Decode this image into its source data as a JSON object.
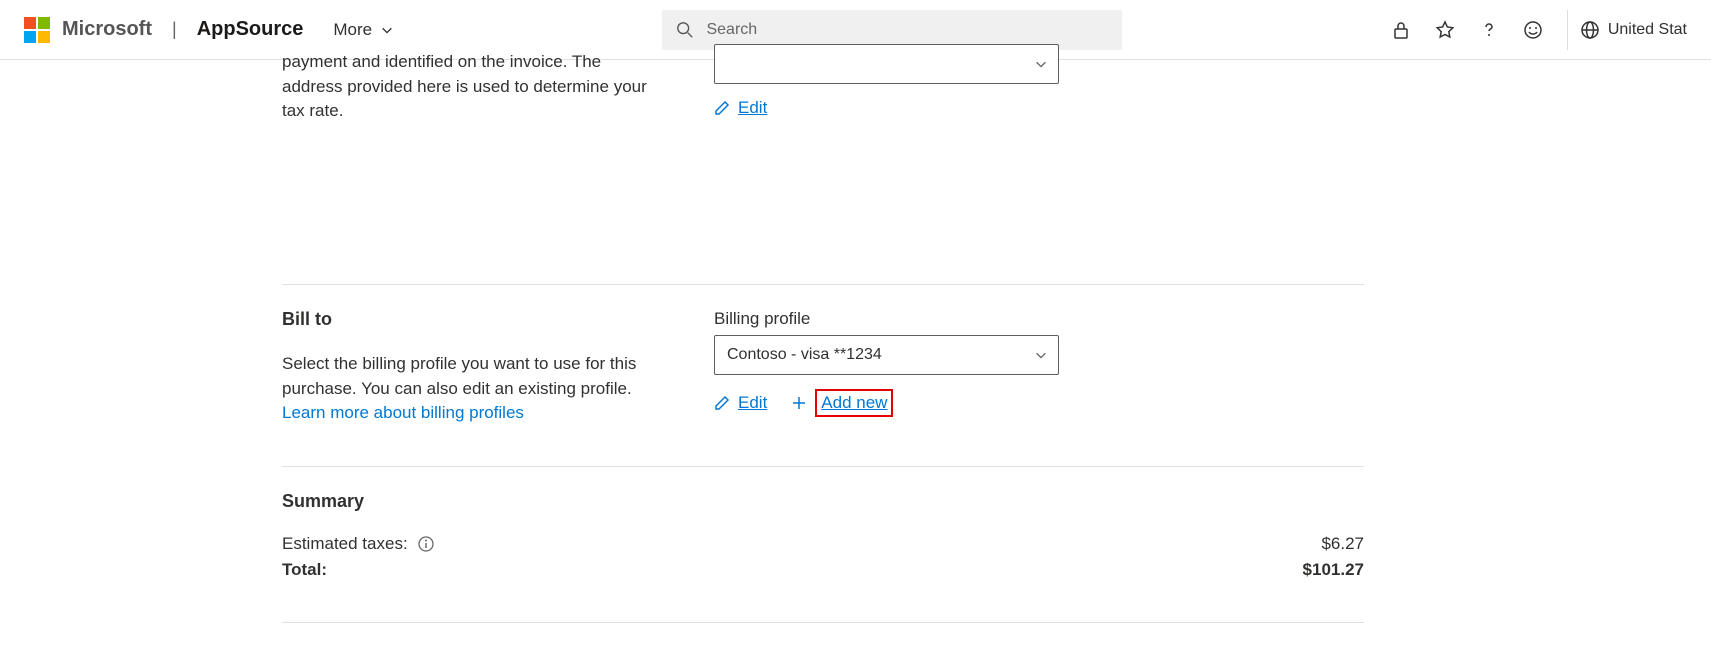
{
  "header": {
    "brand": "Microsoft",
    "product": "AppSource",
    "more": "More",
    "search_placeholder": "Search",
    "region": "United Stat"
  },
  "sold_to": {
    "desc_partial": "payment and identified on the invoice. The address provided here is used to determine your tax rate.",
    "edit": "Edit"
  },
  "bill_to": {
    "title": "Bill to",
    "desc": "Select the billing profile you want to use for this purchase. You can also edit an existing profile. ",
    "learn_more": "Learn more about billing profiles",
    "profile_label": "Billing profile",
    "profile_value": "Contoso - visa **1234",
    "edit": "Edit",
    "add_new": "Add new"
  },
  "summary": {
    "title": "Summary",
    "taxes_label": "Estimated taxes:",
    "taxes_value": "$6.27",
    "total_label": "Total:",
    "total_value": "$101.27"
  }
}
